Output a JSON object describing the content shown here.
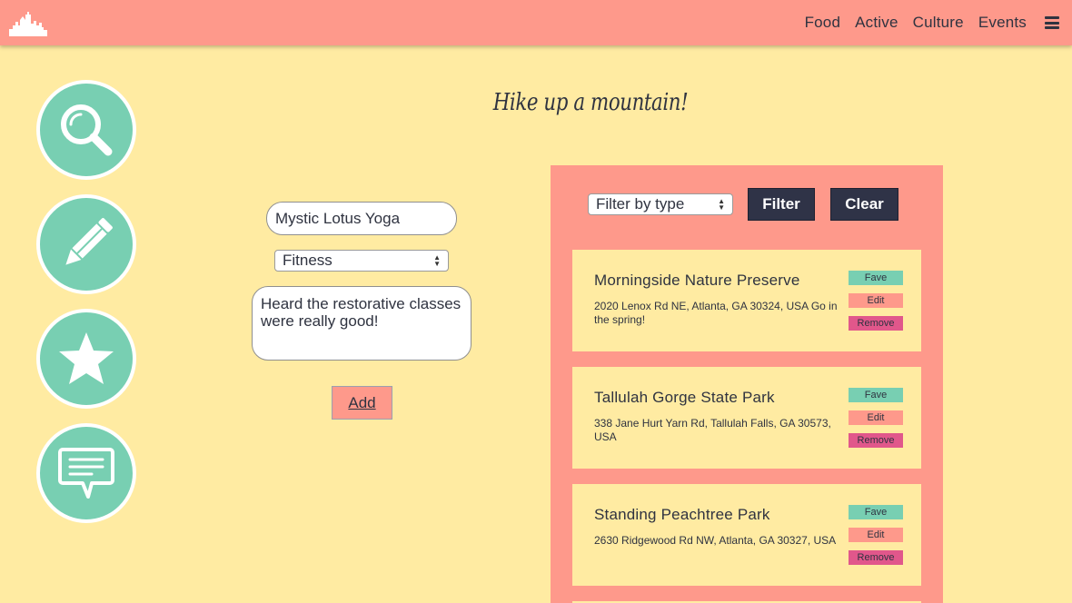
{
  "colors": {
    "navbar": "#fe998b",
    "background": "#ffeba2",
    "teal": "#78cfb2",
    "dark": "#2f3347",
    "pink": "#e1578b"
  },
  "nav": {
    "logo_icon": "city-skyline-icon",
    "links": [
      "Food",
      "Active",
      "Culture",
      "Events"
    ],
    "menu_icon": "hamburger-menu-icon"
  },
  "sidebar": {
    "buttons": [
      {
        "icon": "search-icon"
      },
      {
        "icon": "pencil-icon"
      },
      {
        "icon": "star-icon"
      },
      {
        "icon": "chat-bubble-icon"
      }
    ]
  },
  "main": {
    "title": "Hike up a mountain!"
  },
  "form": {
    "name_value": "Mystic Lotus Yoga",
    "type_value": "Fitness",
    "note_value": "Heard the restorative classes were really good!",
    "add_label": "Add"
  },
  "filter": {
    "select_value": "Filter by type",
    "filter_label": "Filter",
    "clear_label": "Clear"
  },
  "places": [
    {
      "name": "Morningside Nature Preserve",
      "address": "2020 Lenox Rd NE, Atlanta, GA 30324, USA Go in the spring!",
      "fave": "Fave",
      "edit": "Edit",
      "remove": "Remove"
    },
    {
      "name": "Tallulah Gorge State Park",
      "address": "338 Jane Hurt Yarn Rd, Tallulah Falls, GA 30573, USA",
      "fave": "Fave",
      "edit": "Edit",
      "remove": "Remove"
    },
    {
      "name": "Standing Peachtree Park",
      "address": "2630 Ridgewood Rd NW, Atlanta, GA 30327, USA",
      "fave": "Fave",
      "edit": "Edit",
      "remove": "Remove"
    }
  ]
}
